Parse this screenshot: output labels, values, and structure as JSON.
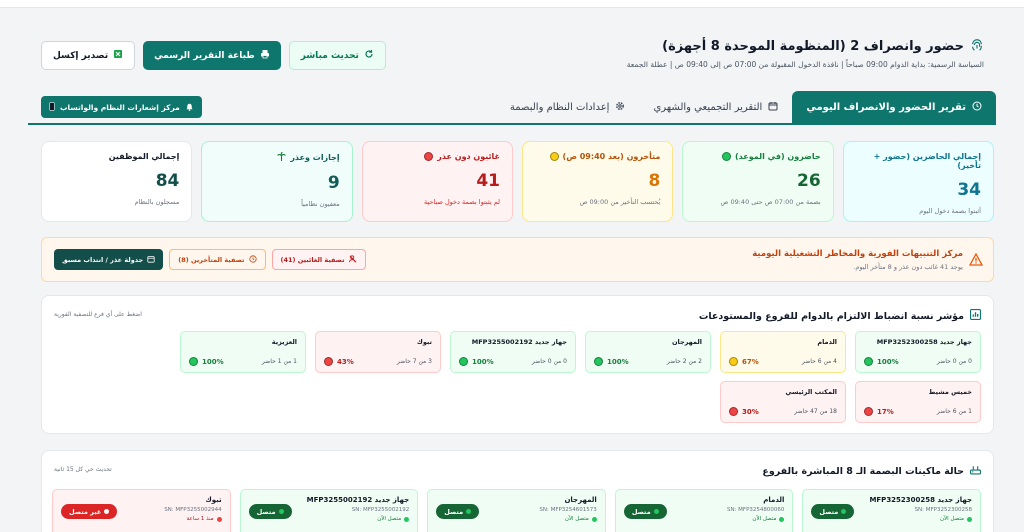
{
  "header": {
    "title": "حضور وانصراف 2 (المنظومة الموحدة 8 أجهزة)",
    "subtitle": "السياسة الرسمية: بداية الدوام 09:00 صباحاً | نافذة الدخول المقبولة من 07:00 ص إلى 09:40 ص | عطلة الجمعة",
    "live_label": "تحديث مباشر",
    "print_label": "طباعة التقرير الرسمي",
    "export_label": "تصدير إكسل"
  },
  "tabs": [
    {
      "label": "تقرير الحضور والانصراف اليومي",
      "active": true
    },
    {
      "label": "التقرير التجميعي والشهري",
      "active": false
    },
    {
      "label": "إعدادات النظام والبصمة",
      "active": false
    }
  ],
  "notify_button": "مركز إشعارات النظام والواتساب",
  "kpis": [
    {
      "label": "إجمالي الحاضرين (حضور + تأخير)",
      "value": "34",
      "hint": "أثبتوا بصمة دخول اليوم",
      "dot": ""
    },
    {
      "label": "حاضرون (في الموعد)",
      "value": "26",
      "hint": "بصمة من 07:00 ص حتى 09:40 ص",
      "dot": "g"
    },
    {
      "label": "متأخرون (بعد 09:40 ص)",
      "value": "8",
      "hint": "يُحتسب التأخير من 09:00 ص",
      "dot": "y"
    },
    {
      "label": "غائبون دون عذر",
      "value": "41",
      "hint": "لم يثبتوا بصمة دخول صباحية",
      "dot": "r"
    },
    {
      "label": "إجازات وعذر",
      "value": "9",
      "hint": "معفيون نظامياً",
      "dot": ""
    },
    {
      "label": "إجمالي الموظفين",
      "value": "84",
      "hint": "مسجلون بالنظام",
      "dot": ""
    }
  ],
  "alert": {
    "title": "مركز التنبيهات الفورية والمخاطر التشغيلية اليومية",
    "subtitle": "يوجد 41 غائب دون عذر و 8 متأخر اليوم.",
    "btn_absent": "تصفية الغائبين (41)",
    "btn_late": "تصفية المتأخرين (8)",
    "btn_schedule": "جدولة عذر / انتداب مسبق"
  },
  "compliance": {
    "title": "مؤشر نسبة انضباط الالتزام بالدوام للفروع والمستودعات",
    "note": "اضغط على أي فرع للتصفية الفورية",
    "branches": [
      {
        "name": "جهاز جديد MFP3252300258",
        "count": "0 من 0 حاضر",
        "pct": "100%",
        "level": "good",
        "dot": "g"
      },
      {
        "name": "الدمام",
        "count": "4 من 6 حاضر",
        "pct": "67%",
        "level": "mid",
        "dot": "y"
      },
      {
        "name": "المهرجان",
        "count": "2 من 2 حاضر",
        "pct": "100%",
        "level": "good",
        "dot": "g"
      },
      {
        "name": "جهاز جديد MFP3255002192",
        "count": "0 من 0 حاضر",
        "pct": "100%",
        "level": "good",
        "dot": "g"
      },
      {
        "name": "تبوك",
        "count": "3 من 7 حاضر",
        "pct": "43%",
        "level": "bad",
        "dot": "r"
      },
      {
        "name": "العزيزية",
        "count": "1 من 1 حاضر",
        "pct": "100%",
        "level": "good",
        "dot": "g"
      },
      {
        "name": "خميس مشيط",
        "count": "1 من 6 حاضر",
        "pct": "17%",
        "level": "bad",
        "dot": "r"
      },
      {
        "name": "المكتب الرئيسي",
        "count": "18 من 47 حاضر",
        "pct": "30%",
        "level": "bad",
        "dot": "r"
      }
    ]
  },
  "devices": {
    "title": "حالة ماكينات البصمة الـ 8 المباشرة بالفروع",
    "note": "تحديث حي كل 15 ثانية",
    "items": [
      {
        "name": "جهاز جديد MFP3252300258",
        "sn": "SN: MFP3252300258",
        "time": "متصل الآن",
        "status": "متصل",
        "on": true
      },
      {
        "name": "الدمام",
        "sn": "SN: MFP3254800060",
        "time": "متصل الآن",
        "status": "متصل",
        "on": true
      },
      {
        "name": "المهرجان",
        "sn": "SN: MFP3254601573",
        "time": "متصل الآن",
        "status": "متصل",
        "on": true
      },
      {
        "name": "جهاز جديد MFP3255002192",
        "sn": "SN: MFP3255002192",
        "time": "متصل الآن",
        "status": "متصل",
        "on": true
      },
      {
        "name": "تبوك",
        "sn": "SN: MFP3255002944",
        "time": "منذ 1 ساعة",
        "status": "غير متصل",
        "on": false
      }
    ]
  }
}
